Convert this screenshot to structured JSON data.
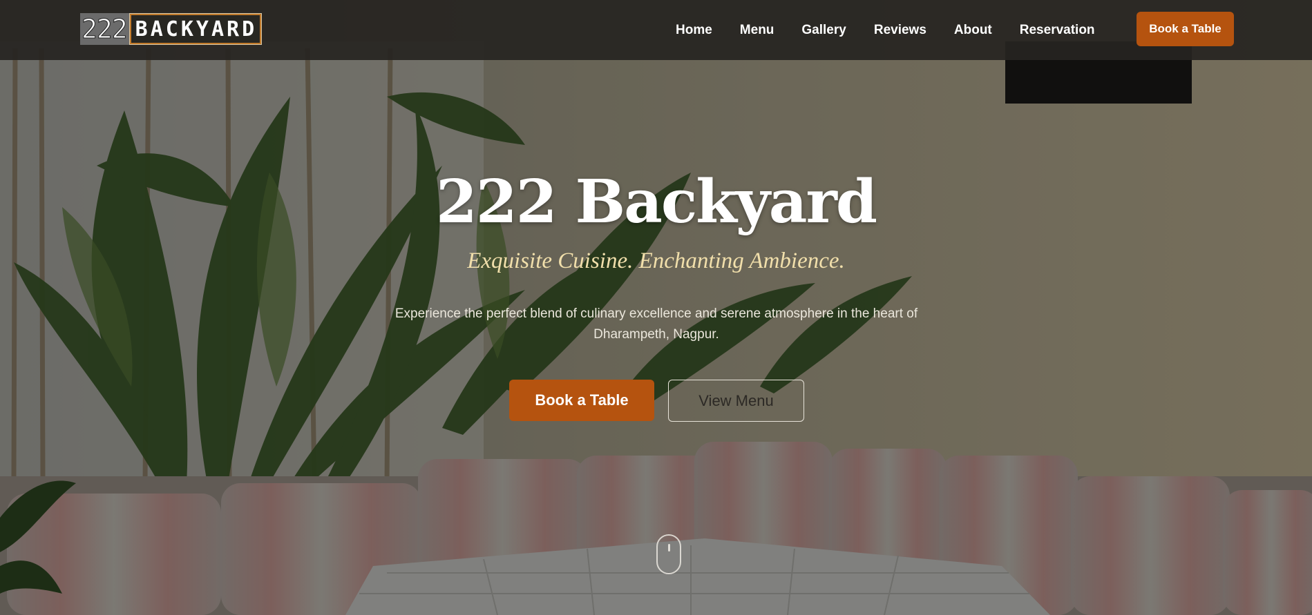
{
  "brand": {
    "logo_number": "222",
    "logo_word": "BACKYARD"
  },
  "nav": {
    "items": [
      {
        "label": "Home"
      },
      {
        "label": "Menu"
      },
      {
        "label": "Gallery"
      },
      {
        "label": "Reviews"
      },
      {
        "label": "About"
      },
      {
        "label": "Reservation"
      }
    ],
    "cta_label": "Book a Table"
  },
  "hero": {
    "title": "222 Backyard",
    "tagline": "Exquisite Cuisine. Enchanting Ambience.",
    "description": "Experience the perfect blend of culinary excellence and serene atmosphere in the heart of Dharampeth, Nagpur.",
    "primary_button": "Book a Table",
    "secondary_button": "View Menu",
    "scroll_icon": "mouse-scroll-icon"
  },
  "colors": {
    "accent": "#b5530f",
    "tagline": "#f1dfab",
    "navbar": "#262421"
  }
}
